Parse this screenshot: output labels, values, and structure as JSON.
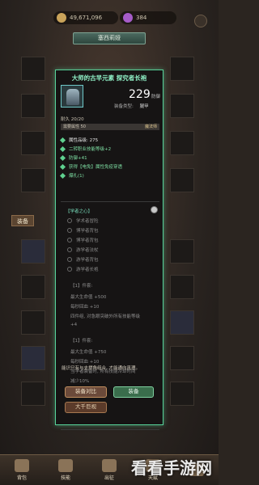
{
  "topbar": {
    "gold": "49,671,096",
    "gems": "384"
  },
  "title_plate": "塞西莉娅",
  "side_labels": {
    "left": "装备",
    "right": ""
  },
  "item": {
    "name": "大师的古早元素 探究者长袍",
    "armor_value": "229",
    "armor_unit": "防御",
    "equip_type_label": "装备类型:",
    "equip_type_value": "腿甲",
    "durability": "耐久 20/20",
    "req_left": "需要属性  50",
    "req_right": "魔法师",
    "attributes": [
      "属性品级: 275",
      "二转职业技能等级+2",
      "防御+41",
      "获得【电免】属性免疫穿透",
      "爆扎(1)"
    ],
    "set_title": "【学者之心】",
    "set_items": [
      "学术者冒险",
      "博学者背包",
      "博学者背包",
      "游学者法杖",
      "游学者背包",
      "游学者长袍"
    ],
    "effects": [
      "【1】件套:",
      "最大生命值 +500",
      "每秒回血 +10",
      "四件组, 对急眼突破外所有技能等级",
      "+4",
      "【1】件套:",
      "最大生命值 +750",
      "每秒回血 +10",
      "当学者装备时, 所有技能冷却时间",
      "减少10%"
    ],
    "hint": "能识只有与支燃角组合, 才能通向真理。"
  },
  "buttons": {
    "compare": "装备对比",
    "equip": "装备",
    "details": "大千巨视"
  },
  "bottom_nav": [
    "背包",
    "技能",
    "出征",
    "天赋",
    ""
  ],
  "watermark": "看看手游网"
}
